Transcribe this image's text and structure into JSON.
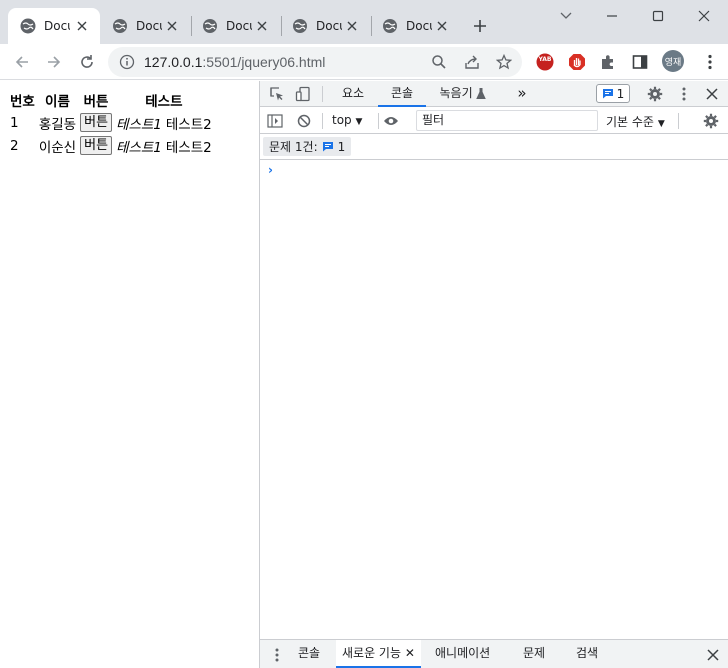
{
  "tabs": [
    {
      "title": "Document",
      "active": true
    },
    {
      "title": "Document",
      "active": false
    },
    {
      "title": "Document",
      "active": false
    },
    {
      "title": "Document",
      "active": false
    },
    {
      "title": "Document",
      "active": false
    }
  ],
  "address": {
    "host": "127.0.0.1",
    "path": ":5501/jquery06.html"
  },
  "extensions": {
    "yab_label": "YAB"
  },
  "profile": {
    "initials": "영재"
  },
  "page": {
    "headers": [
      "번호",
      "이름",
      "버튼",
      "테스트"
    ],
    "rows": [
      {
        "num": "1",
        "name": "홍길동",
        "button": "버튼",
        "test1": "테스트1",
        "test2": "테스트2"
      },
      {
        "num": "2",
        "name": "이순신",
        "button": "버튼",
        "test1": "테스트1",
        "test2": "테스트2"
      }
    ]
  },
  "devtools": {
    "tabs": [
      "요소",
      "콘솔",
      "녹음기"
    ],
    "more": "»",
    "issue_count": "1",
    "context": "top",
    "filter_placeholder": "필터",
    "levels": "기본 수준",
    "issues_label": "문제 1건:",
    "issues_count": "1",
    "prompt": "›",
    "drawer_tabs": [
      "콘솔",
      "새로운 기능",
      "애니메이션",
      "문제",
      "검색"
    ]
  },
  "colors": {
    "accent": "#1a73e8",
    "tabstrip": "#dee1e6",
    "yab": "#c5221f",
    "adblock": "#d93025"
  }
}
